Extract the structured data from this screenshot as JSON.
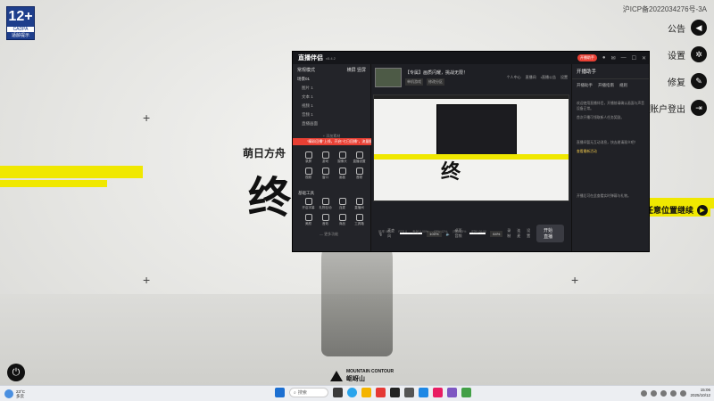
{
  "launcher": {
    "rating": {
      "age": "12+",
      "org": "CADPA",
      "tip": "适龄提示"
    },
    "icp": "沪ICP备2022034276号-3A",
    "menu": [
      {
        "label": "公告",
        "icon": "announce-icon",
        "glyph": "◀"
      },
      {
        "label": "设置",
        "icon": "gear-icon",
        "glyph": "✲"
      },
      {
        "label": "修复",
        "icon": "wrench-icon",
        "glyph": "✎"
      },
      {
        "label": "账户登出",
        "icon": "logout-icon",
        "glyph": "⇥"
      }
    ],
    "continue_label": "任意位置继续",
    "title_small": "萌日方舟",
    "title_big": "终",
    "mountain_en": "MOUNTAIN CONTOUR",
    "mountain_cn": "岖岈山",
    "colors": {
      "accent": "#f0e800",
      "dark": "#111111"
    }
  },
  "app": {
    "logo": "直播伴侣",
    "version": "v5.4.2",
    "live_pill": "开播助手",
    "left": {
      "mode_label": "常规模式",
      "tab_a": "横屏",
      "tab_b": "竖屏",
      "scene_title": "场景01",
      "scenes": [
        "图片 1",
        "文本 1",
        "视频 1",
        "音频 1",
        "直播画面"
      ],
      "add_scene": "+ 添加素材",
      "notice": "“精彩回播”上线，开启“七日回播”，流量翻倍提升",
      "tools_row1": [
        "录屏",
        "游戏",
        "摄像头",
        "直播设置"
      ],
      "tools_row2": [
        "视频",
        "窗口",
        "画板",
        "音频"
      ],
      "basic_title": "基础工具",
      "basic_row1": [
        "开启字幕",
        "礼物互动",
        "连麦",
        "直播间"
      ],
      "basic_row2": [
        "美颜",
        "音效",
        "商品",
        "工具箱"
      ],
      "more": "— 更多功能"
    },
    "center": {
      "title": "【专属】画质闪耀，挑战无限！",
      "tags": [
        "单机游戏",
        "修改分区"
      ],
      "header_links": [
        "个人中心",
        "直播间",
        "•直播公告",
        "设置"
      ],
      "volume_label": "麦克风",
      "volume_pct": "100%",
      "desktop_label": "桌面音频",
      "desktop_pct": "64%",
      "icons": [
        "录制",
        "连麦",
        "设置"
      ],
      "go_live": "开始直播",
      "status": [
        "码率 0kb/s",
        "FPS 0",
        "丢帧 0.00%",
        "CPU 12%",
        "内存 63%",
        "时长 00:00"
      ]
    },
    "right": {
      "title": "开播助手",
      "tabs": [
        "开播助手",
        "开播指南",
        "规则"
      ],
      "texts": [
        "欢迎使用直播伴侣，开播前请确认画面与声音设备正常。",
        "首次开播可领取新人任务奖励。",
        "直播间暂无互动消息，快去邀请观众吧！",
        "开播后可在此查看实时弹幕与礼物。"
      ],
      "highlight": "查看最新活动"
    }
  },
  "taskbar": {
    "weather_temp": "23°C",
    "weather_desc": "多云",
    "search": "搜索",
    "time": "15:06",
    "date": "2025/10/12"
  }
}
